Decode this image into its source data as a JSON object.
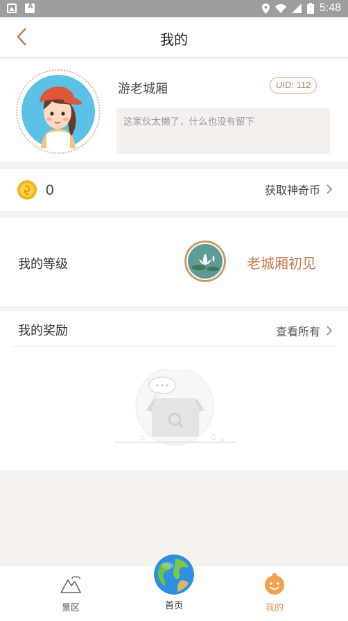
{
  "status_bar": {
    "time": "5:48",
    "icons": [
      "image-icon",
      "a-icon",
      "location-icon",
      "wifi-icon",
      "signal-icon",
      "battery-icon"
    ]
  },
  "header": {
    "title": "我的",
    "back_icon": "chevron-left-icon"
  },
  "profile": {
    "username": "游老城厢",
    "uid": "UID: 112",
    "signature": "这家伙太懒了，什么也没有留下"
  },
  "coins": {
    "count": "0",
    "link_label": "获取神奇币"
  },
  "level": {
    "label": "我的等级",
    "name": "老城厢初见"
  },
  "rewards": {
    "title": "我的奖励",
    "link_label": "查看所有"
  },
  "tabbar": {
    "items": [
      {
        "label": "景区",
        "icon": "mountain-icon"
      },
      {
        "label": "首页",
        "icon": "globe-icon"
      },
      {
        "label": "我的",
        "icon": "smiley-icon"
      }
    ],
    "active": 2
  },
  "colors": {
    "accent": "#c67b4f",
    "active_tab": "#e29a56",
    "page_bg": "#f6f2ee"
  }
}
